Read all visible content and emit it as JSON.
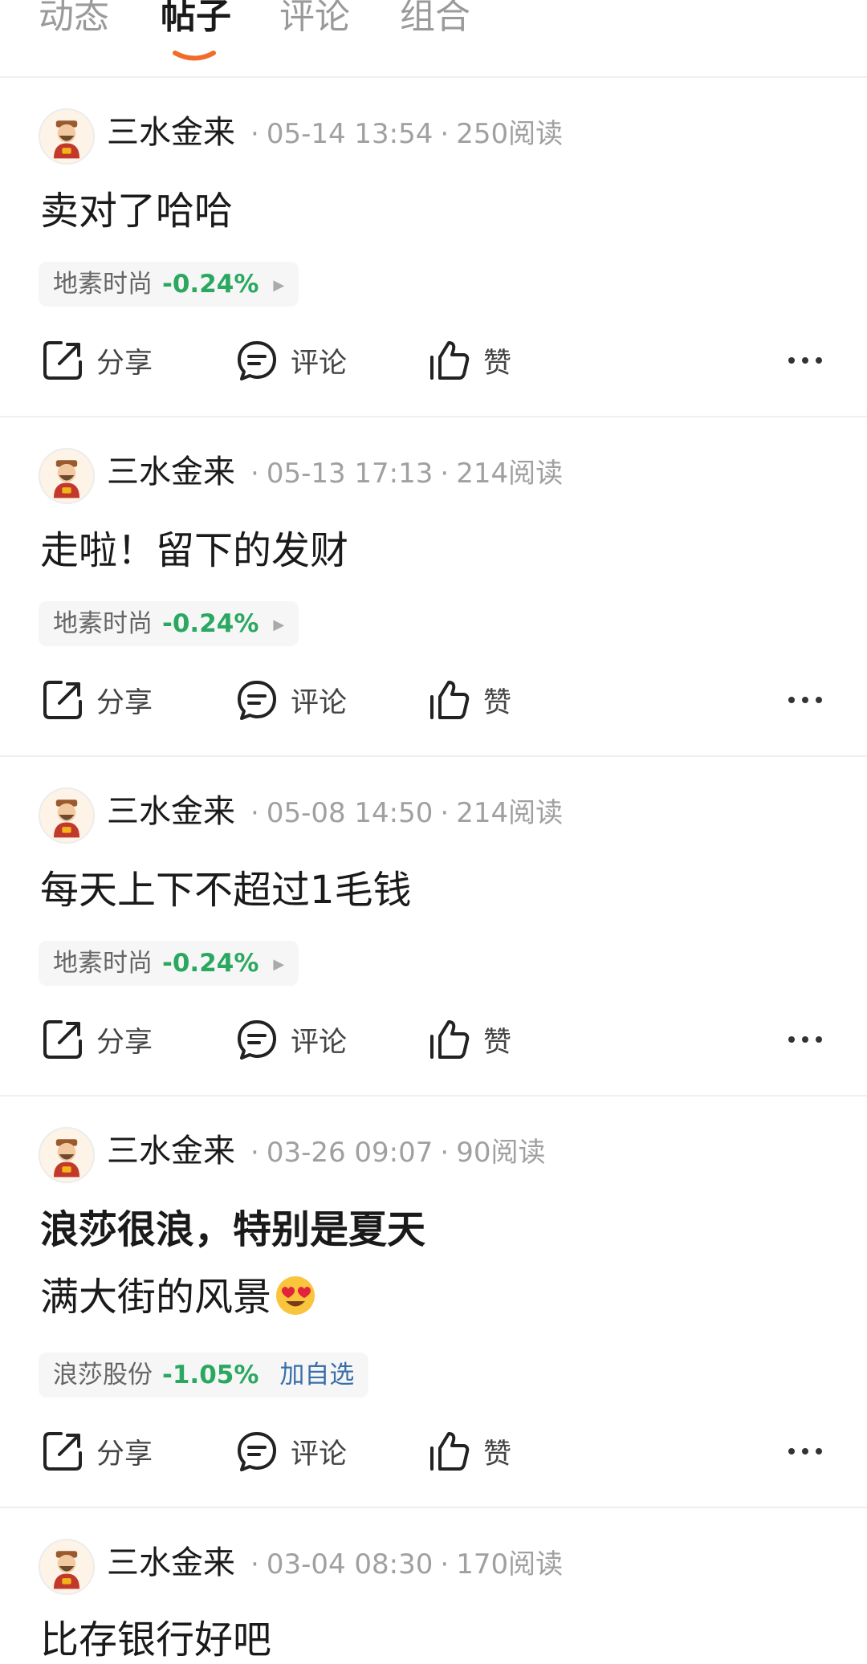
{
  "tabs": [
    {
      "label": "动态",
      "active": false
    },
    {
      "label": "帖子",
      "active": true
    },
    {
      "label": "评论",
      "active": false
    },
    {
      "label": "组合",
      "active": false
    }
  ],
  "accent_color": "#f26b2a",
  "up_color": "#2aa860",
  "actions": {
    "share": "分享",
    "comment": "评论",
    "like": "赞"
  },
  "posts": [
    {
      "author": "三水金来",
      "time": "05-14 13:54",
      "reads": "250阅读",
      "title": "",
      "text": "卖对了哈哈",
      "stock": {
        "name": "地素时尚",
        "change": "-0.24%",
        "add_label": ""
      }
    },
    {
      "author": "三水金来",
      "time": "05-13 17:13",
      "reads": "214阅读",
      "title": "",
      "text": "走啦！留下的发财",
      "stock": {
        "name": "地素时尚",
        "change": "-0.24%",
        "add_label": ""
      }
    },
    {
      "author": "三水金来",
      "time": "05-08 14:50",
      "reads": "214阅读",
      "title": "",
      "text": "每天上下不超过1毛钱",
      "stock": {
        "name": "地素时尚",
        "change": "-0.24%",
        "add_label": ""
      }
    },
    {
      "author": "三水金来",
      "time": "03-26 09:07",
      "reads": "90阅读",
      "title": "浪莎很浪，特别是夏天",
      "text": "满大街的风景",
      "stock": {
        "name": "浪莎股份",
        "change": "-1.05%",
        "add_label": "加自选"
      }
    },
    {
      "author": "三水金来",
      "time": "03-04 08:30",
      "reads": "170阅读",
      "title": "",
      "text": "比存银行好吧",
      "stock": null
    }
  ]
}
